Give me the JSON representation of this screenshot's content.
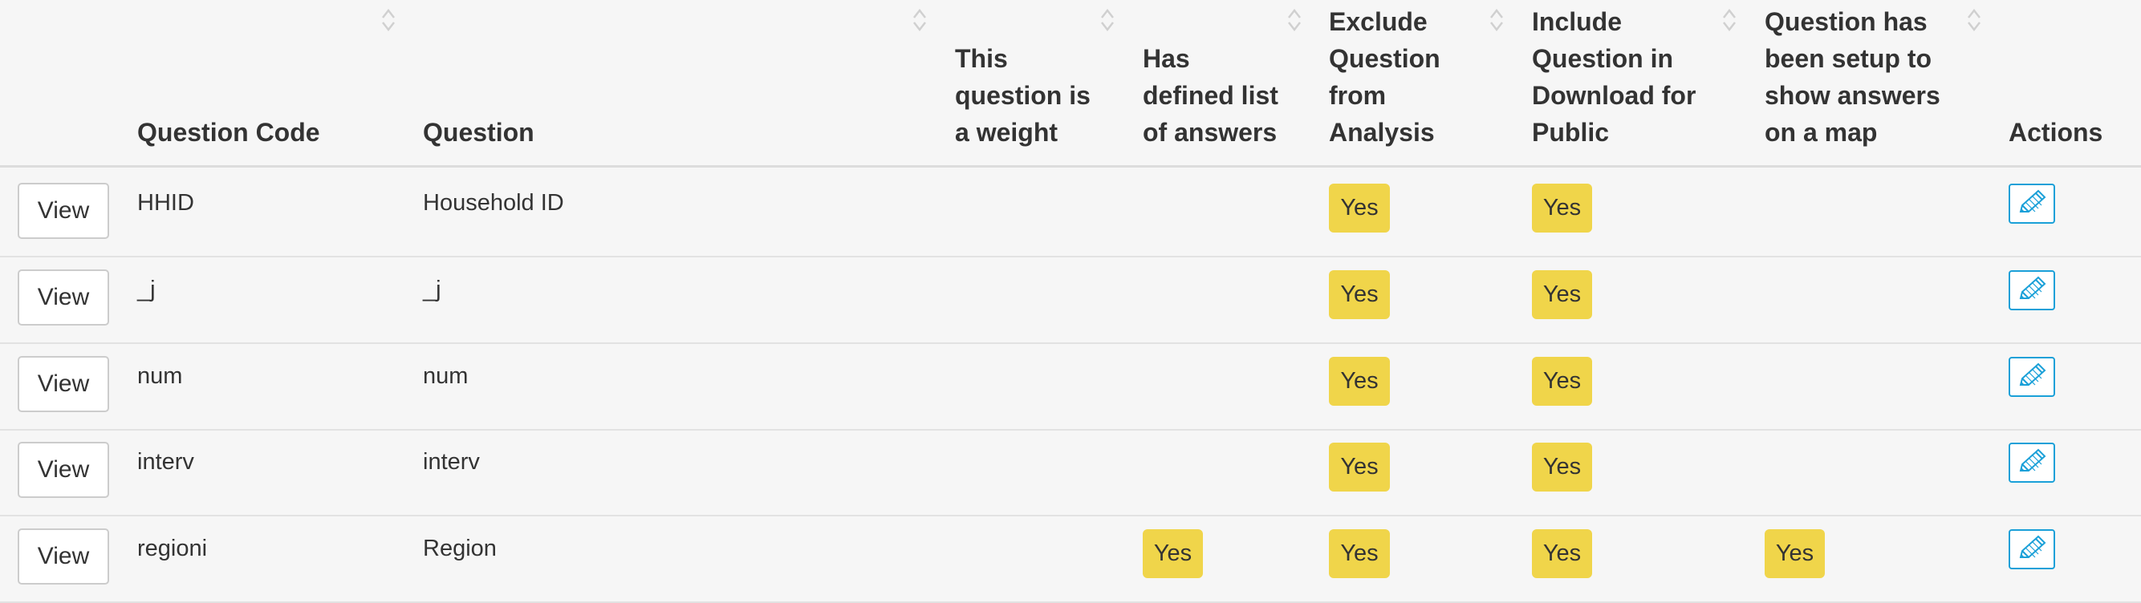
{
  "table": {
    "columns": [
      {
        "key": "view",
        "label": ""
      },
      {
        "key": "code",
        "label": "Question Code"
      },
      {
        "key": "question",
        "label": "Question"
      },
      {
        "key": "weight",
        "label": "This question is a weight",
        "lines": [
          "This",
          "question is",
          "a weight"
        ]
      },
      {
        "key": "defined_list",
        "label": "Has defined list of answers",
        "lines": [
          "Has",
          "defined list",
          "of answers"
        ]
      },
      {
        "key": "exclude",
        "label": "Exclude Question from Analysis",
        "lines": [
          "Exclude",
          "Question",
          "from",
          "Analysis"
        ]
      },
      {
        "key": "include_public",
        "label": "Include Question in Download for Public",
        "lines": [
          "Include",
          "Question in",
          "Download for",
          "Public"
        ]
      },
      {
        "key": "map",
        "label": "Question has been setup to show answers on a map",
        "lines": [
          "Question has",
          "been setup to",
          "show answers",
          "on a map"
        ]
      },
      {
        "key": "actions",
        "label": "Actions"
      }
    ],
    "view_label": "View",
    "yes_label": "Yes",
    "rows": [
      {
        "code": "HHID",
        "question": "Household ID",
        "weight": "",
        "defined_list": "",
        "exclude": "Yes",
        "include_public": "Yes",
        "map": ""
      },
      {
        "code": "_j",
        "question": "_j",
        "weight": "",
        "defined_list": "",
        "exclude": "Yes",
        "include_public": "Yes",
        "map": ""
      },
      {
        "code": "num",
        "question": "num",
        "weight": "",
        "defined_list": "",
        "exclude": "Yes",
        "include_public": "Yes",
        "map": ""
      },
      {
        "code": "interv",
        "question": "interv",
        "weight": "",
        "defined_list": "",
        "exclude": "Yes",
        "include_public": "Yes",
        "map": ""
      },
      {
        "code": "regioni",
        "question": "Region",
        "weight": "",
        "defined_list": "Yes",
        "exclude": "Yes",
        "include_public": "Yes",
        "map": "Yes"
      }
    ]
  },
  "icons": {
    "sort": "sort-icon",
    "edit": "pencil-edit-icon"
  },
  "colors": {
    "badge": "#f0d54a",
    "edit_border": "#1aa0d8",
    "background": "#f6f6f6"
  }
}
